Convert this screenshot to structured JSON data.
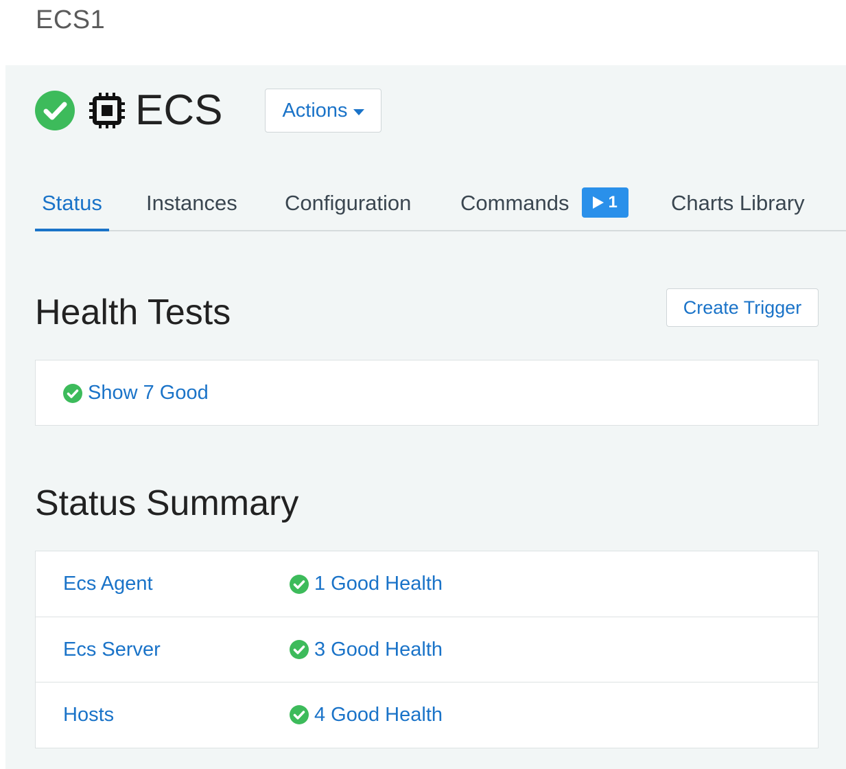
{
  "page": {
    "cluster_name": "ECS1"
  },
  "service": {
    "title": "ECS",
    "status_icon": "check-circle-icon",
    "type_icon": "chip-icon",
    "actions_label": "Actions"
  },
  "tabs": [
    {
      "label": "Status",
      "active": true
    },
    {
      "label": "Instances",
      "active": false
    },
    {
      "label": "Configuration",
      "active": false
    },
    {
      "label": "Commands",
      "active": false,
      "badge": "1"
    },
    {
      "label": "Charts Library",
      "active": false
    }
  ],
  "health_tests": {
    "heading": "Health Tests",
    "create_trigger_label": "Create Trigger",
    "show_good_label": "Show 7 Good"
  },
  "status_summary": {
    "heading": "Status Summary",
    "rows": [
      {
        "name": "Ecs Agent",
        "health": "1 Good Health"
      },
      {
        "name": "Ecs Server",
        "health": "3 Good Health"
      },
      {
        "name": "Hosts",
        "health": "4 Good Health"
      }
    ]
  },
  "colors": {
    "accent": "#1a73c8",
    "good": "#3dbb5b",
    "badge": "#2a90ea",
    "panel_bg": "#f2f6f6"
  }
}
